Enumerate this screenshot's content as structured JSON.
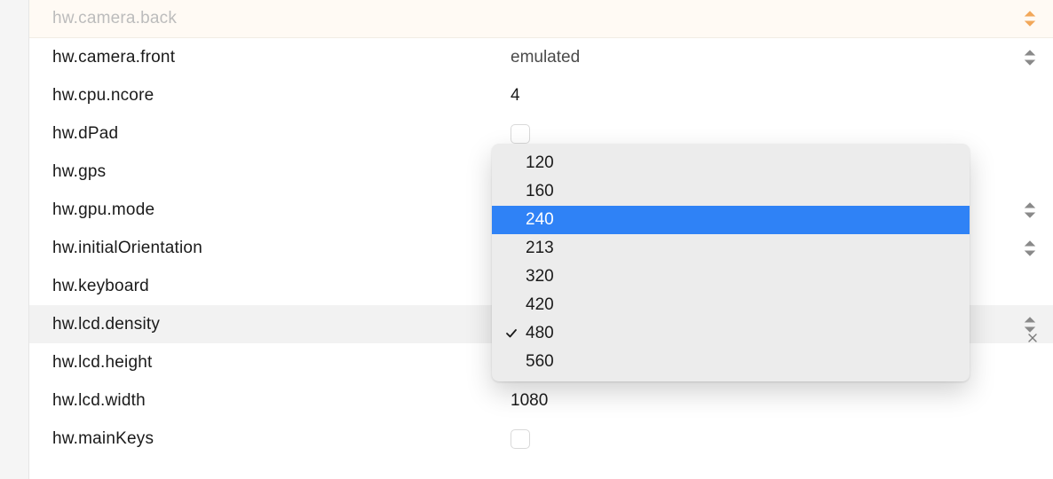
{
  "rows": [
    {
      "label": "hw.camera.back",
      "kind": "select",
      "value": "",
      "dim": true,
      "stepper": "orange",
      "firstRow": true
    },
    {
      "label": "hw.camera.front",
      "kind": "select",
      "value": "emulated",
      "stepper": "gray"
    },
    {
      "label": "hw.cpu.ncore",
      "kind": "number",
      "value": "4"
    },
    {
      "label": "hw.dPad",
      "kind": "checkbox",
      "checked": false
    },
    {
      "label": "hw.gps",
      "kind": "checkbox",
      "checked": false,
      "hiddenValue": true
    },
    {
      "label": "hw.gpu.mode",
      "kind": "select",
      "value": "",
      "stepper": "gray"
    },
    {
      "label": "hw.initialOrientation",
      "kind": "select",
      "value": "",
      "stepper": "gray"
    },
    {
      "label": "hw.keyboard",
      "kind": "checkbox",
      "checked": false,
      "hiddenValue": true
    },
    {
      "label": "hw.lcd.density",
      "kind": "select",
      "value": "",
      "stepper": "gray",
      "selected": true,
      "clearable": true
    },
    {
      "label": "hw.lcd.height",
      "kind": "number",
      "value": "",
      "hiddenValue": true
    },
    {
      "label": "hw.lcd.width",
      "kind": "number",
      "value": "1080"
    },
    {
      "label": "hw.mainKeys",
      "kind": "checkbox",
      "checked": false
    }
  ],
  "dropdown": {
    "options": [
      "120",
      "160",
      "240",
      "213",
      "320",
      "420",
      "480",
      "560"
    ],
    "highlighted": "240",
    "checked": "480"
  }
}
